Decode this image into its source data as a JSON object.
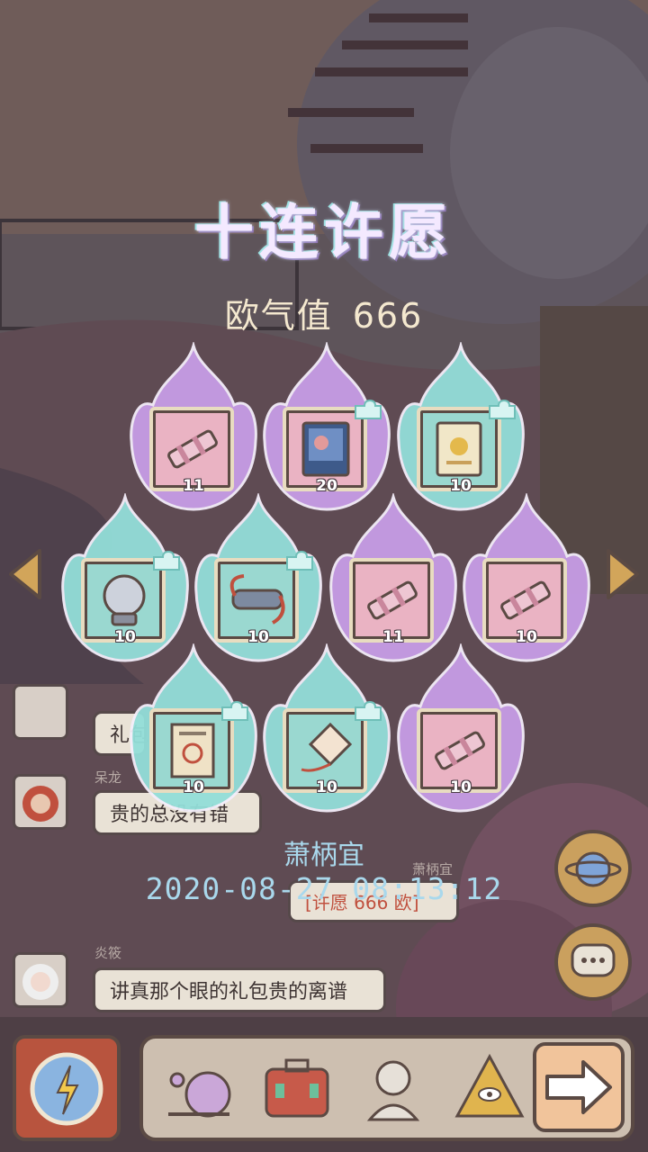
{
  "title": "十连许愿",
  "luck": {
    "label": "欧气值",
    "value": "666"
  },
  "items": [
    {
      "icon": "telescope-icon",
      "count": "11",
      "color": "pink",
      "flame": "purple"
    },
    {
      "icon": "painting-book-icon",
      "count": "20",
      "color": "pink",
      "flame": "purple",
      "badge": true
    },
    {
      "icon": "gold-book-icon",
      "count": "10",
      "color": "teal",
      "flame": "cyan",
      "badge": true
    },
    {
      "icon": "crystal-ball-icon",
      "count": "10",
      "color": "teal",
      "flame": "cyan",
      "badge": true
    },
    {
      "icon": "goggles-icon",
      "count": "10",
      "color": "teal",
      "flame": "cyan",
      "badge": true
    },
    {
      "icon": "telescope-icon",
      "count": "11",
      "color": "pink",
      "flame": "purple"
    },
    {
      "icon": "telescope-icon",
      "count": "10",
      "color": "pink",
      "flame": "purple"
    },
    {
      "icon": "certificate-icon",
      "count": "10",
      "color": "teal",
      "flame": "cyan",
      "badge": true
    },
    {
      "icon": "kite-icon",
      "count": "10",
      "color": "teal",
      "flame": "cyan",
      "badge": true
    },
    {
      "icon": "telescope-icon",
      "count": "10",
      "color": "pink",
      "flame": "purple"
    }
  ],
  "player_name": "萧柄宜",
  "timestamp": "2020-08-27 08:13:12",
  "chat": [
    {
      "name": "",
      "text": "礼包"
    },
    {
      "name": "呆龙",
      "text": "贵的总没有错"
    },
    {
      "name": "萧柄宜",
      "text": "[许愿 666 欧]"
    },
    {
      "name": "炎筱",
      "text": "讲真那个眼的礼包贵的离谱"
    }
  ],
  "colors": {
    "pink_card": "#eab3c3",
    "teal_card": "#9ad8d0",
    "purple_flame": "#c79de6",
    "cyan_flame": "#93ded9"
  }
}
